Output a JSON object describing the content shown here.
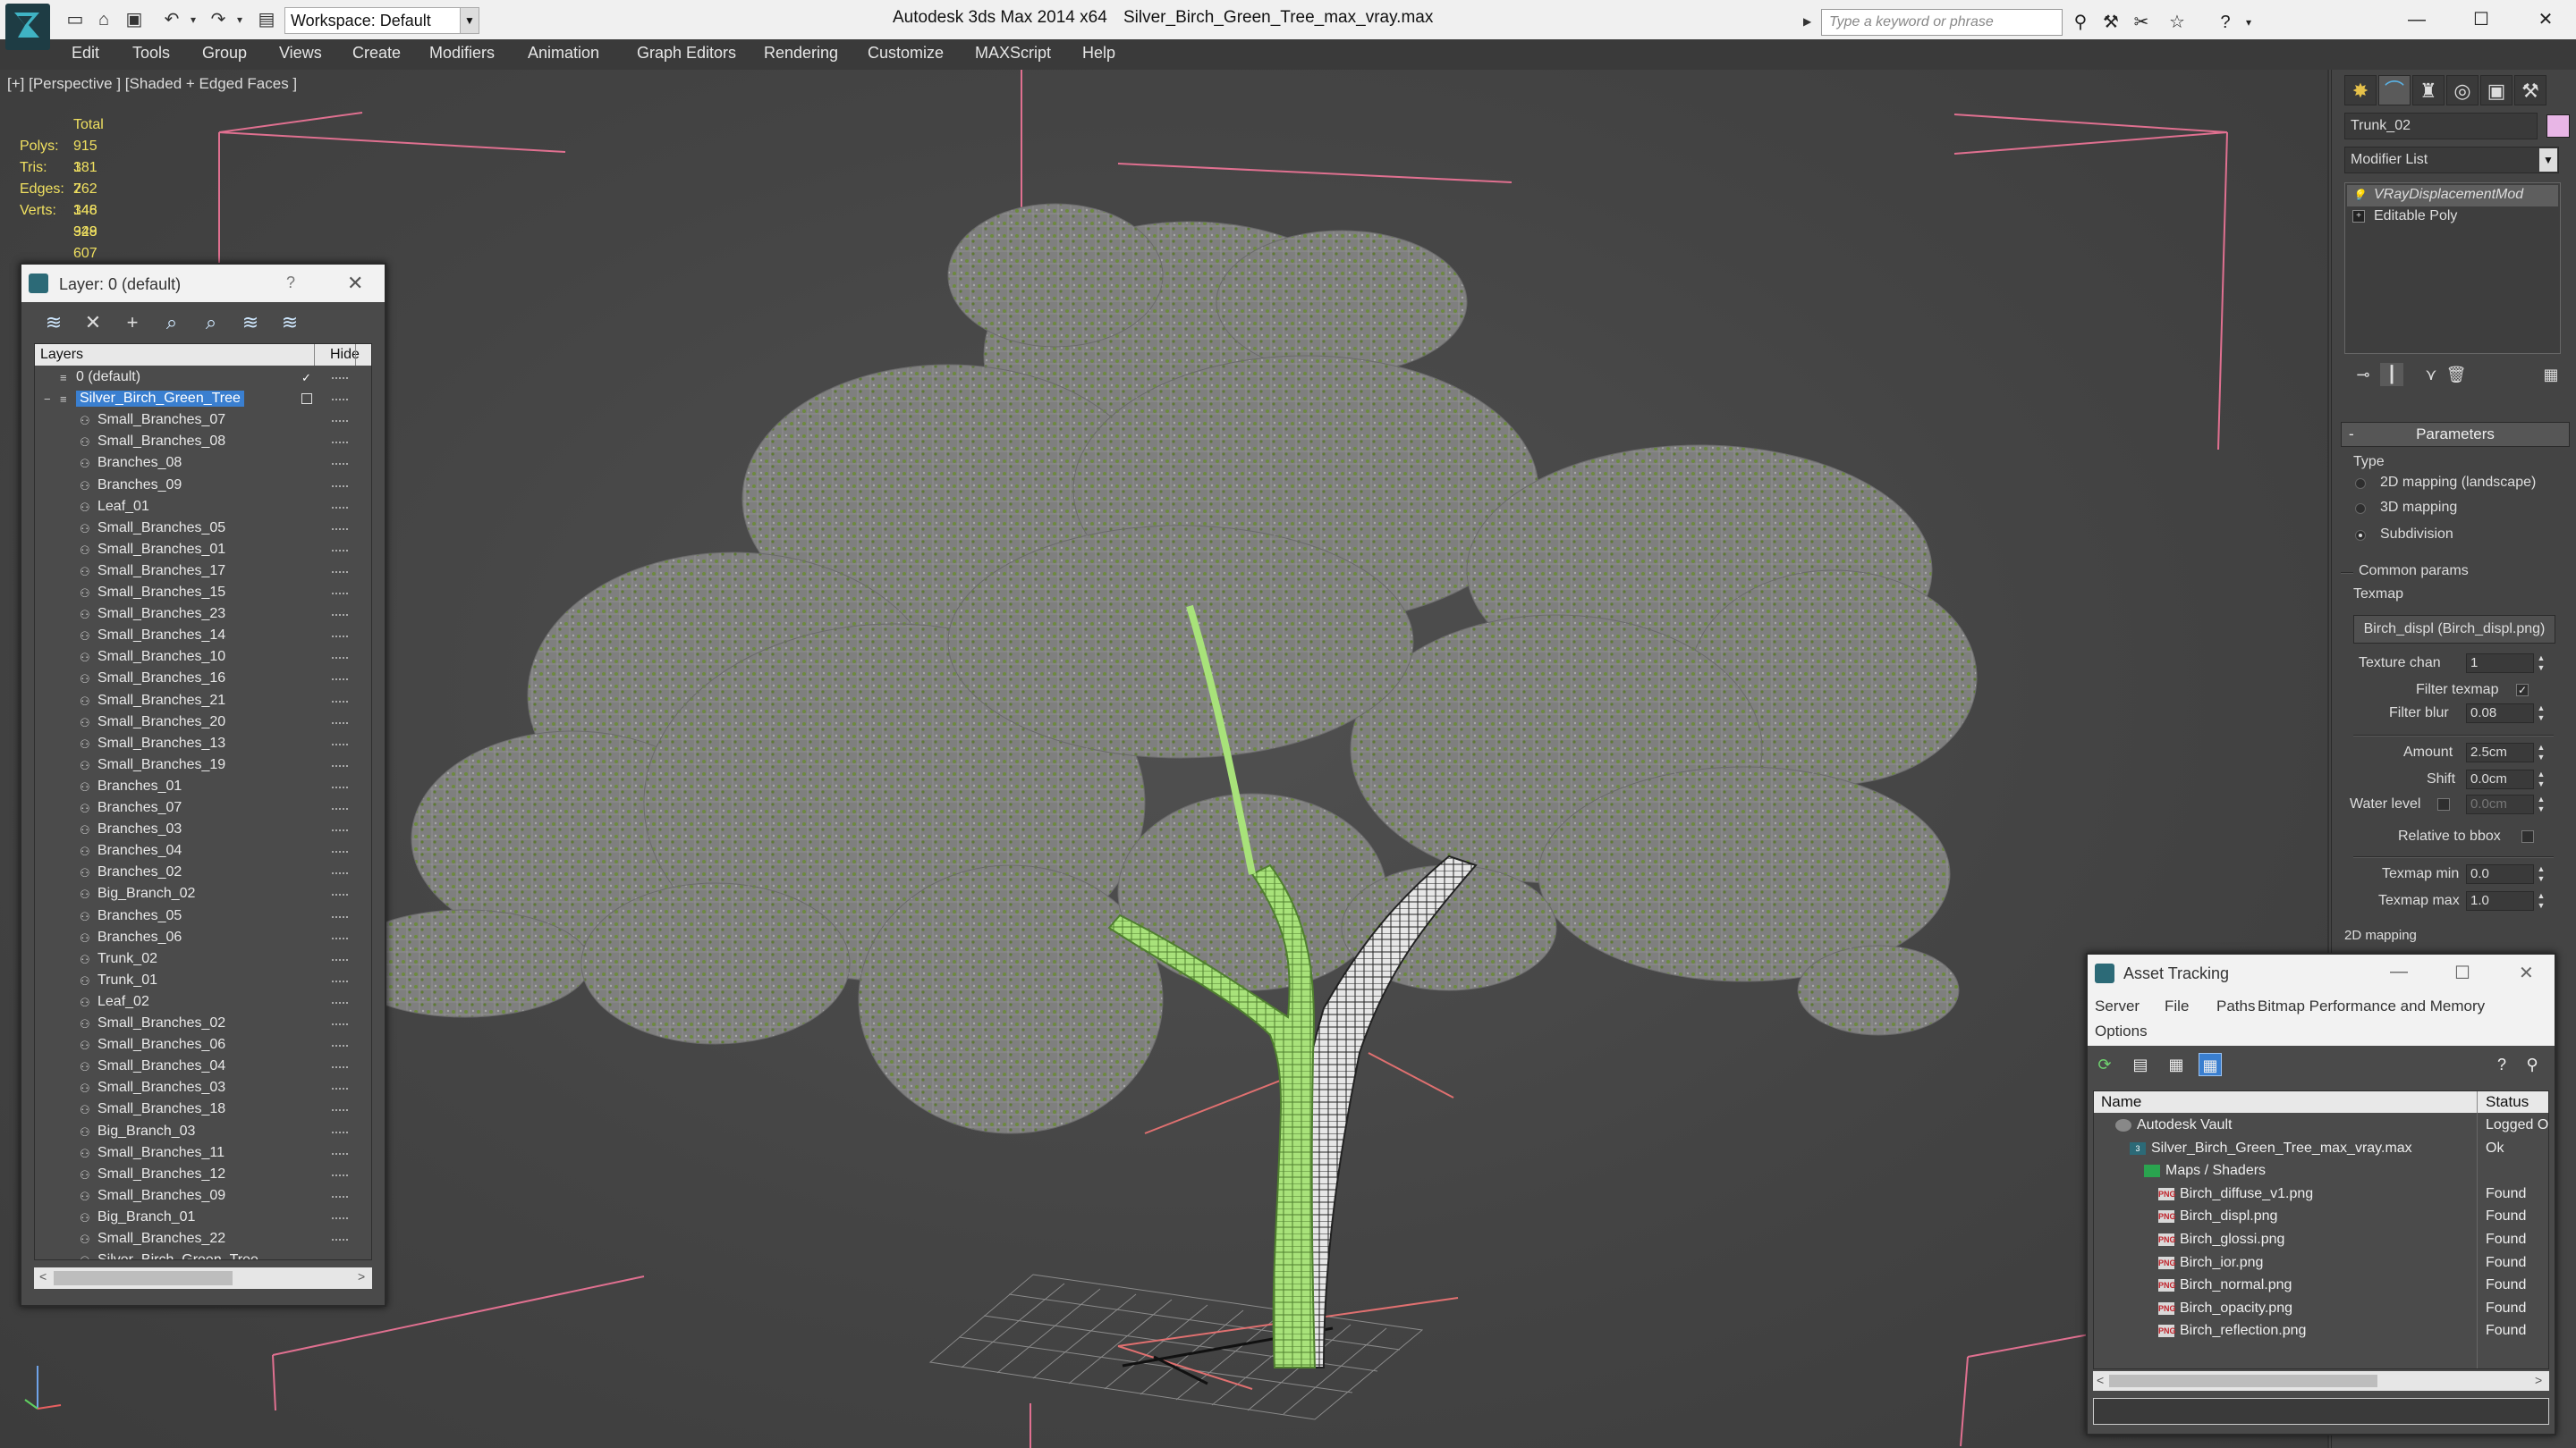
{
  "titlebar": {
    "workspace": "Workspace: Default",
    "app_title": "Autodesk 3ds Max  2014 x64",
    "file_title": "Silver_Birch_Green_Tree_max_vray.max",
    "search_placeholder": "Type a keyword or phrase",
    "window_buttons": [
      "—",
      "☐",
      "✕"
    ]
  },
  "menu": [
    "Edit",
    "Tools",
    "Group",
    "Views",
    "Create",
    "Modifiers",
    "Animation",
    "Graph Editors",
    "Rendering",
    "Customize",
    "MAXScript",
    "Help"
  ],
  "viewport": {
    "label": "[+] [Perspective ] [Shaded + Edged Faces ]",
    "stats": {
      "header": "Total",
      "rows": [
        {
          "label": "Polys:",
          "value": "915 381"
        },
        {
          "label": "Tris:",
          "value": "1 762 346"
        },
        {
          "label": "Edges:",
          "value": "2 148 948"
        },
        {
          "label": "Verts:",
          "value": "1 329 607"
        }
      ]
    }
  },
  "layer_window": {
    "title": "Layer: 0 (default)",
    "help": "?",
    "close": "✕",
    "col_layers": "Layers",
    "col_hide": "Hide",
    "rows": [
      {
        "name": "0 (default)",
        "level": 0,
        "checked": true
      },
      {
        "name": "Silver_Birch_Green_Tree",
        "level": 0,
        "selected": true
      },
      {
        "name": "Small_Branches_07",
        "level": 1
      },
      {
        "name": "Small_Branches_08",
        "level": 1
      },
      {
        "name": "Branches_08",
        "level": 1
      },
      {
        "name": "Branches_09",
        "level": 1
      },
      {
        "name": "Leaf_01",
        "level": 1
      },
      {
        "name": "Small_Branches_05",
        "level": 1
      },
      {
        "name": "Small_Branches_01",
        "level": 1
      },
      {
        "name": "Small_Branches_17",
        "level": 1
      },
      {
        "name": "Small_Branches_15",
        "level": 1
      },
      {
        "name": "Small_Branches_23",
        "level": 1
      },
      {
        "name": "Small_Branches_14",
        "level": 1
      },
      {
        "name": "Small_Branches_10",
        "level": 1
      },
      {
        "name": "Small_Branches_16",
        "level": 1
      },
      {
        "name": "Small_Branches_21",
        "level": 1
      },
      {
        "name": "Small_Branches_20",
        "level": 1
      },
      {
        "name": "Small_Branches_13",
        "level": 1
      },
      {
        "name": "Small_Branches_19",
        "level": 1
      },
      {
        "name": "Branches_01",
        "level": 1
      },
      {
        "name": "Branches_07",
        "level": 1
      },
      {
        "name": "Branches_03",
        "level": 1
      },
      {
        "name": "Branches_04",
        "level": 1
      },
      {
        "name": "Branches_02",
        "level": 1
      },
      {
        "name": "Big_Branch_02",
        "level": 1
      },
      {
        "name": "Branches_05",
        "level": 1
      },
      {
        "name": "Branches_06",
        "level": 1
      },
      {
        "name": "Trunk_02",
        "level": 1
      },
      {
        "name": "Trunk_01",
        "level": 1
      },
      {
        "name": "Leaf_02",
        "level": 1
      },
      {
        "name": "Small_Branches_02",
        "level": 1
      },
      {
        "name": "Small_Branches_06",
        "level": 1
      },
      {
        "name": "Small_Branches_04",
        "level": 1
      },
      {
        "name": "Small_Branches_03",
        "level": 1
      },
      {
        "name": "Small_Branches_18",
        "level": 1
      },
      {
        "name": "Big_Branch_03",
        "level": 1
      },
      {
        "name": "Small_Branches_11",
        "level": 1
      },
      {
        "name": "Small_Branches_12",
        "level": 1
      },
      {
        "name": "Small_Branches_09",
        "level": 1
      },
      {
        "name": "Big_Branch_01",
        "level": 1
      },
      {
        "name": "Small_Branches_22",
        "level": 1
      },
      {
        "name": "Silver_Birch_Green_Tree",
        "level": 1
      }
    ]
  },
  "command_panel": {
    "object_name": "Trunk_02",
    "object_color": "#e8b6e6",
    "modifier_list": "Modifier List",
    "stack": [
      "VRayDisplacementMod",
      "Editable Poly"
    ],
    "rollout_title": "Parameters",
    "type_label": "Type",
    "type_options": [
      {
        "label": "2D mapping (landscape)",
        "selected": false
      },
      {
        "label": "3D mapping",
        "selected": false
      },
      {
        "label": "Subdivision",
        "selected": true
      }
    ],
    "common_params": "Common params",
    "texmap_label": "Texmap",
    "texmap_value": "Birch_displ (Birch_displ.png)",
    "texture_chan_label": "Texture chan",
    "texture_chan_value": "1",
    "filter_texmap_label": "Filter texmap",
    "filter_blur_label": "Filter blur",
    "filter_blur_value": "0.08",
    "amount_label": "Amount",
    "amount_value": "2.5cm",
    "shift_label": "Shift",
    "shift_value": "0.0cm",
    "water_level_label": "Water level",
    "water_level_value": "0.0cm",
    "relative_bbox_label": "Relative to bbox",
    "texmap_min_label": "Texmap min",
    "texmap_min_value": "0.0",
    "texmap_max_label": "Texmap max",
    "texmap_max_value": "1.0",
    "next_group": "2D mapping"
  },
  "asset_tracking": {
    "title": "Asset Tracking",
    "menu_row1": [
      "Server",
      "File",
      "Paths",
      "Bitmap Performance and Memory"
    ],
    "menu_row2": [
      "Options"
    ],
    "col_name": "Name",
    "col_status": "Status",
    "rows": [
      {
        "name": "Autodesk Vault",
        "status": "Logged Ou",
        "icon": "vault",
        "indent": 0
      },
      {
        "name": "Silver_Birch_Green_Tree_max_vray.max",
        "status": "Ok",
        "icon": "max",
        "indent": 1
      },
      {
        "name": "Maps / Shaders",
        "status": "",
        "icon": "folder",
        "indent": 2
      },
      {
        "name": "Birch_diffuse_v1.png",
        "status": "Found",
        "icon": "png",
        "indent": 3
      },
      {
        "name": "Birch_displ.png",
        "status": "Found",
        "icon": "png",
        "indent": 3
      },
      {
        "name": "Birch_glossi.png",
        "status": "Found",
        "icon": "png",
        "indent": 3
      },
      {
        "name": "Birch_ior.png",
        "status": "Found",
        "icon": "png",
        "indent": 3
      },
      {
        "name": "Birch_normal.png",
        "status": "Found",
        "icon": "png",
        "indent": 3
      },
      {
        "name": "Birch_opacity.png",
        "status": "Found",
        "icon": "png",
        "indent": 3
      },
      {
        "name": "Birch_reflection.png",
        "status": "Found",
        "icon": "png",
        "indent": 3
      }
    ]
  }
}
